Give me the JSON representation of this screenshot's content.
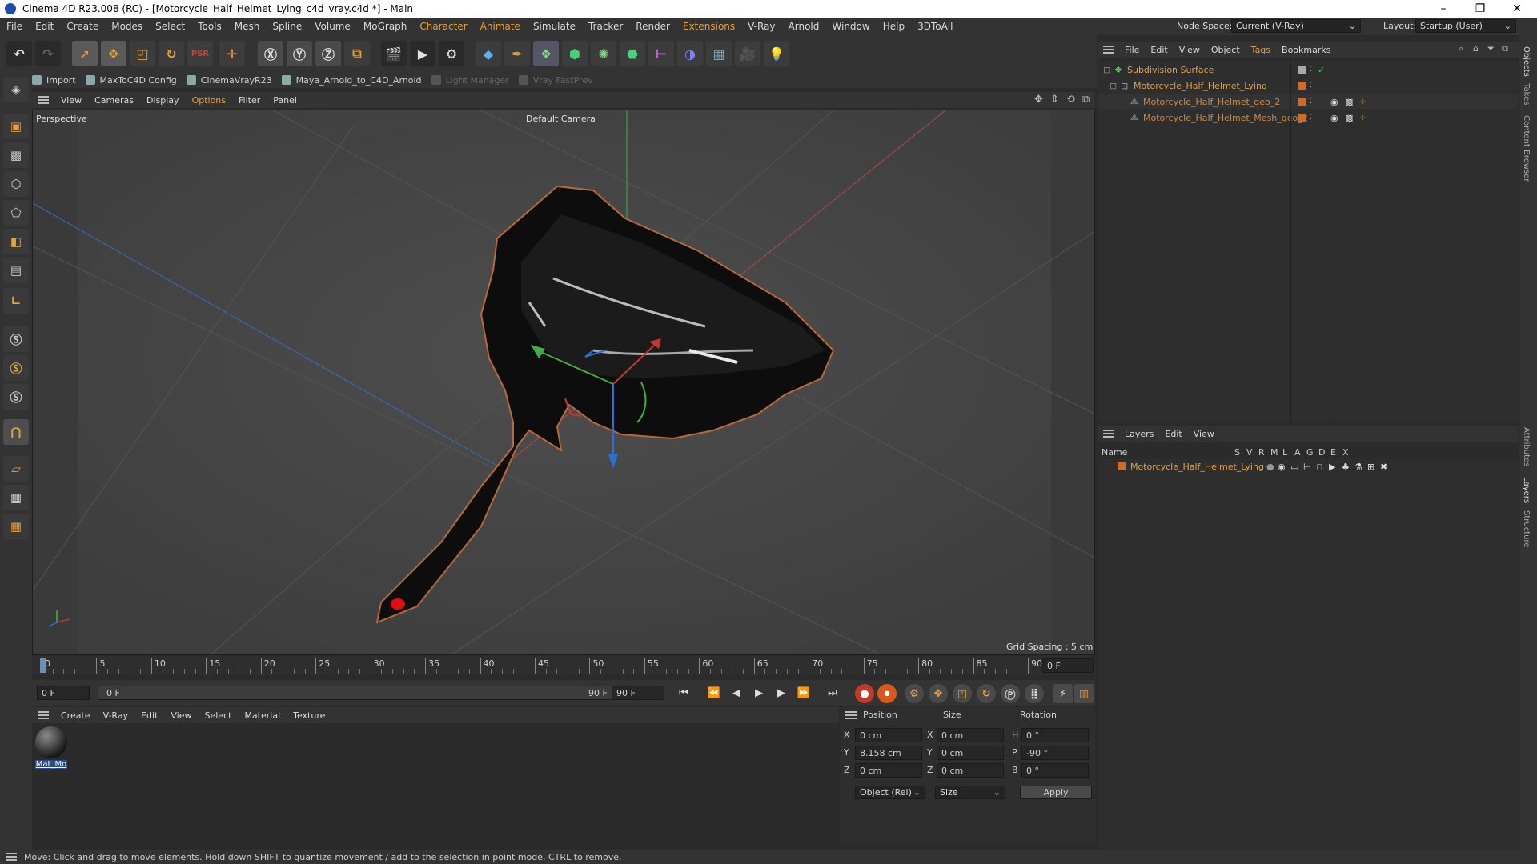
{
  "window": {
    "title": "Cinema 4D R23.008 (RC) - [Motorcycle_Half_Helmet_Lying_c4d_vray.c4d *] - Main",
    "controls": [
      "–",
      "❐",
      "✕"
    ]
  },
  "menubar": {
    "items": [
      "File",
      "Edit",
      "Create",
      "Modes",
      "Select",
      "Tools",
      "Mesh",
      "Spline",
      "Volume",
      "MoGraph",
      "Character",
      "Animate",
      "Simulate",
      "Tracker",
      "Render",
      "Extensions",
      "V-Ray",
      "Arnold",
      "Window",
      "Help",
      "3DToAll"
    ],
    "highlighted": [
      "Character",
      "Animate",
      "Extensions"
    ],
    "node_space_label": "Node Space:",
    "node_space_value": "Current (V-Ray)",
    "layout_label": "Layout:",
    "layout_value": "Startup (User)"
  },
  "plugin_bar": {
    "items": [
      {
        "label": "Import",
        "enabled": true
      },
      {
        "label": "MaxToC4D Config",
        "enabled": true
      },
      {
        "label": "CinemaVrayR23",
        "enabled": true
      },
      {
        "label": "Maya_Arnold_to_C4D_Arnold",
        "enabled": true
      },
      {
        "label": "Light Manager",
        "enabled": false
      },
      {
        "label": "Vray FastPrev",
        "enabled": false
      }
    ]
  },
  "viewport": {
    "menu": [
      "View",
      "Cameras",
      "Display",
      "Options",
      "Filter",
      "Panel"
    ],
    "highlighted": "Options",
    "view_name": "Perspective",
    "camera": "Default Camera",
    "grid_spacing": "Grid Spacing : 5 cm"
  },
  "timeline": {
    "ticks": [
      "0",
      "5",
      "10",
      "15",
      "20",
      "25",
      "30",
      "35",
      "40",
      "45",
      "50",
      "55",
      "60",
      "65",
      "70",
      "75",
      "80",
      "85",
      "90"
    ],
    "current_frame": "0 F",
    "start_field": "0 F",
    "range_start": "0 F",
    "range_end": "90 F",
    "end_field": "90 F"
  },
  "material_manager": {
    "menu": [
      "Create",
      "V-Ray",
      "Edit",
      "View",
      "Select",
      "Material",
      "Texture"
    ],
    "materials": [
      {
        "name": "Mat_Mo"
      }
    ]
  },
  "attributes": {
    "headers": [
      "Position",
      "Size",
      "Rotation"
    ],
    "rows": [
      {
        "axis": "X",
        "pos": "0 cm",
        "size_axis": "X",
        "size": "0 cm",
        "rot_axis": "H",
        "rot": "0 °"
      },
      {
        "axis": "Y",
        "pos": "8.158 cm",
        "size_axis": "Y",
        "size": "0 cm",
        "rot_axis": "P",
        "rot": "-90 °"
      },
      {
        "axis": "Z",
        "pos": "0 cm",
        "size_axis": "Z",
        "size": "0 cm",
        "rot_axis": "B",
        "rot": "0 °"
      }
    ],
    "coord_mode": "Object (Rel)",
    "size_mode": "Size",
    "apply_label": "Apply"
  },
  "object_manager": {
    "menu": [
      "File",
      "Edit",
      "View",
      "Object",
      "Tags",
      "Bookmarks"
    ],
    "highlighted": "Tags",
    "objects": [
      {
        "name": "Subdivision Surface",
        "level": 0
      },
      {
        "name": "Motorcycle_Half_Helmet_Lying",
        "level": 1
      },
      {
        "name": "Motorcycle_Half_Helmet_geo_2",
        "level": 2
      },
      {
        "name": "Motorcycle_Half_Helmet_Mesh_geo_2",
        "level": 2
      }
    ]
  },
  "layer_manager": {
    "menu": [
      "Layers",
      "Edit",
      "View"
    ],
    "columns": [
      "Name",
      "S",
      "V",
      "R",
      "M",
      "L",
      "A",
      "G",
      "D",
      "E",
      "X"
    ],
    "layers": [
      {
        "name": "Motorcycle_Half_Helmet_Lying",
        "color": "#d0692a"
      }
    ]
  },
  "right_tabs": [
    "Objects",
    "Takes",
    "Content Browser",
    "Attributes",
    "Layers",
    "Structure"
  ],
  "status": "Move: Click and drag to move elements. Hold down SHIFT to quantize movement / add to the selection in point mode, CTRL to remove.",
  "colors": {
    "accent": "#e6a03c",
    "x_axis": "#c0392b",
    "y_axis": "#3fae49",
    "z_axis": "#2e6fd6",
    "layer": "#d0692a"
  }
}
